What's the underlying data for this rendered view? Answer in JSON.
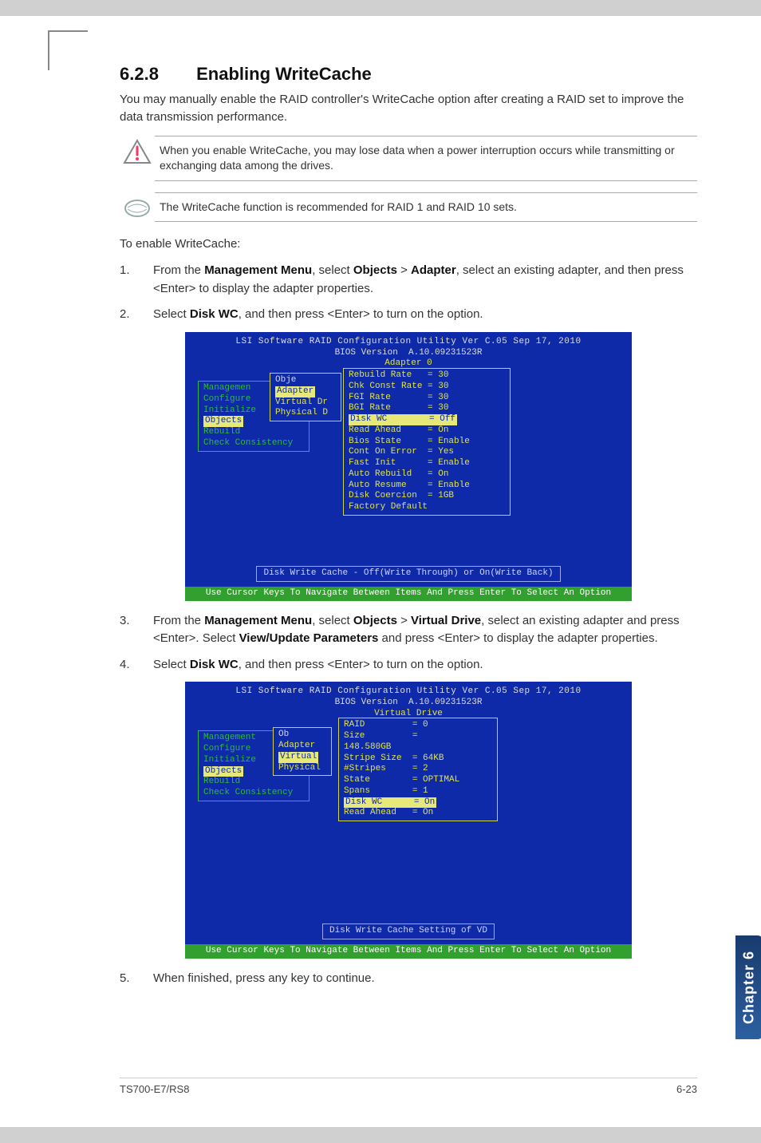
{
  "section": {
    "number": "6.2.8",
    "title": "Enabling WriteCache"
  },
  "intro": "You may manually enable the RAID controller's WriteCache option after creating a RAID set to improve the data transmission performance.",
  "warning": "When you enable WriteCache, you may lose data when a power interruption occurs while transmitting or exchanging data among the drives.",
  "note": "The WriteCache function is recommended for RAID 1 and RAID 10 sets.",
  "lead": "To enable WriteCache:",
  "steps": {
    "s1_n": "1.",
    "s1_a": "From the ",
    "s1_b1": "Management Menu",
    "s1_c": ", select ",
    "s1_b2": "Objects",
    "s1_d": " > ",
    "s1_b3": "Adapter",
    "s1_e": ", select an existing adapter, and then press <Enter> to display the adapter properties.",
    "s2_n": "2.",
    "s2_a": "Select ",
    "s2_b": "Disk WC",
    "s2_c": ", and then press <Enter> to turn on the option.",
    "s3_n": "3.",
    "s3_a": "From the ",
    "s3_b1": "Management Menu",
    "s3_c": ", select ",
    "s3_b2": "Objects",
    "s3_d": " > ",
    "s3_b3": "Virtual Drive",
    "s3_e": ", select an existing adapter and press <Enter>. Select ",
    "s3_b4": "View/Update Parameters",
    "s3_f": " and press <Enter> to display the adapter properties.",
    "s4_n": "4.",
    "s4_a": "Select ",
    "s4_b": "Disk WC",
    "s4_c": ", and then press <Enter> to turn on the option.",
    "s5_n": "5.",
    "s5_a": "When finished, press any key to continue."
  },
  "bios1": {
    "title": "LSI Software RAID Configuration Utility Ver C.05 Sep 17, 2010",
    "version_label": "BIOS Version",
    "version": "A.10.09231523R",
    "panel_title": "Adapter 0",
    "menu_title": "Managemen",
    "obj_label": "Obje",
    "menu_items": [
      "Configure",
      "Initialize",
      "Objects",
      "Rebuild",
      "Check Consistency"
    ],
    "sub_items": [
      "Adapter",
      "Virtual Dr",
      "Physical D"
    ],
    "props": [
      {
        "k": "Rebuild Rate",
        "v": "= 30"
      },
      {
        "k": "Chk Const Rate",
        "v": "= 30"
      },
      {
        "k": "FGI Rate",
        "v": "= 30"
      },
      {
        "k": "BGI Rate",
        "v": "= 30"
      },
      {
        "k": "Disk WC",
        "v": "= Off",
        "sel": true
      },
      {
        "k": "Read Ahead",
        "v": "= On"
      },
      {
        "k": "Bios State",
        "v": "= Enable"
      },
      {
        "k": "Cont On Error",
        "v": "= Yes"
      },
      {
        "k": "Fast Init",
        "v": "= Enable"
      },
      {
        "k": "Auto Rebuild",
        "v": "= On"
      },
      {
        "k": "Auto Resume",
        "v": "= Enable"
      },
      {
        "k": "Disk Coercion",
        "v": "= 1GB"
      },
      {
        "k": "Factory Default",
        "v": ""
      }
    ],
    "hint": "Disk Write Cache - Off(Write Through) or On(Write Back)",
    "footer": "Use Cursor Keys To Navigate Between Items And Press Enter To Select An Option"
  },
  "bios2": {
    "title": "LSI Software RAID Configuration Utility Ver C.05 Sep 17, 2010",
    "version_label": "BIOS Version",
    "version": "A.10.09231523R",
    "panel_title": "Virtual Drive",
    "menu_title": "Management",
    "obj_label": "Ob",
    "menu_items": [
      "Configure",
      "Initialize",
      "Objects",
      "Rebuild",
      "Check Consistency"
    ],
    "sub_items": [
      "Adapter",
      "Virtual",
      "Physical"
    ],
    "props": [
      {
        "k": "RAID",
        "v": "= 0"
      },
      {
        "k": "Size",
        "v": "="
      },
      {
        "k": "148.580GB",
        "v": ""
      },
      {
        "k": "Stripe Size",
        "v": "= 64KB"
      },
      {
        "k": "#Stripes",
        "v": "= 2"
      },
      {
        "k": "State",
        "v": "= OPTIMAL"
      },
      {
        "k": "Spans",
        "v": "= 1"
      },
      {
        "k": "Disk WC",
        "v": "= On",
        "sel": true
      },
      {
        "k": "Read Ahead",
        "v": "= On"
      }
    ],
    "hint": "Disk Write Cache Setting of VD",
    "footer": "Use Cursor Keys To Navigate Between Items And Press Enter To Select An Option"
  },
  "sidetab": "Chapter 6",
  "footer": {
    "left": "TS700-E7/RS8",
    "right": "6-23"
  }
}
